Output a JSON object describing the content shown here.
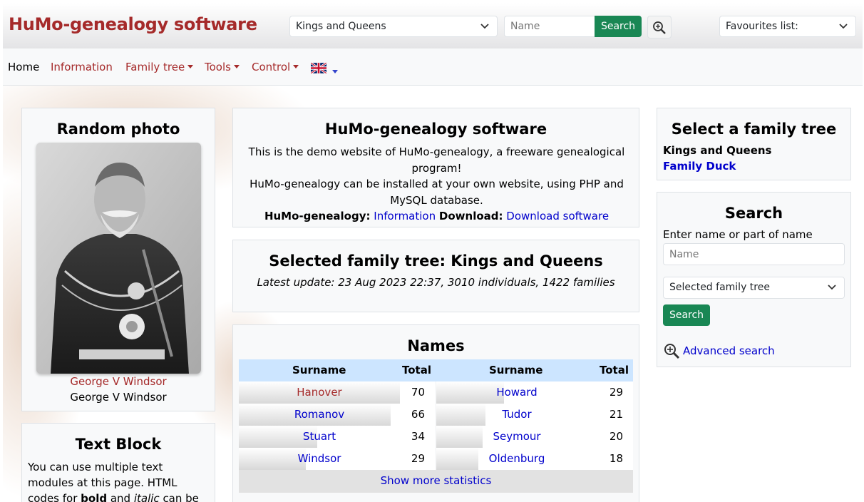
{
  "header": {
    "site_title": "HuMo-genealogy software",
    "tree_select_value": "Kings and Queens",
    "name_placeholder": "Name",
    "search_label": "Search",
    "favourites_label": "Favourites list:"
  },
  "nav": {
    "items": [
      {
        "label": "Home"
      },
      {
        "label": "Information"
      },
      {
        "label": "Family tree"
      },
      {
        "label": "Tools"
      },
      {
        "label": "Control"
      }
    ],
    "language_icon": "uk-flag-icon"
  },
  "random_photo": {
    "title": "Random photo",
    "link_text": "George V Windsor",
    "caption": "George V Windsor"
  },
  "text_block": {
    "title": "Text Block",
    "line1": "You can use multiple text modules at this page. HTML codes for ",
    "bold": "bold",
    "and": " and ",
    "italic": "italic",
    "tail": " can be"
  },
  "intro": {
    "title": "HuMo-genealogy software",
    "line1": "This is the demo website of HuMo-genealogy, a freeware genealogical program!",
    "line2": "HuMo-genealogy can be installed at your own website, using PHP and MySQL database.",
    "label_humo": "HuMo-genealogy:",
    "link_information": "Information",
    "label_download": "Download:",
    "link_download": "Download software"
  },
  "selected_tree": {
    "title": "Selected family tree: Kings and Queens",
    "update": "Latest update: 23 Aug 2023 22:37, 3010 individuals, 1422 families"
  },
  "names": {
    "title": "Names",
    "col_surname": "Surname",
    "col_total": "Total",
    "rows": [
      {
        "left_name": "Hanover",
        "left_total": "70",
        "right_name": "Howard",
        "right_total": "29"
      },
      {
        "left_name": "Romanov",
        "left_total": "66",
        "right_name": "Tudor",
        "right_total": "21"
      },
      {
        "left_name": "Stuart",
        "left_total": "34",
        "right_name": "Seymour",
        "right_total": "20"
      },
      {
        "left_name": "Windsor",
        "left_total": "29",
        "right_name": "Oldenburg",
        "right_total": "18"
      }
    ],
    "show_more": "Show more statistics"
  },
  "select_family_tree": {
    "title": "Select a family tree",
    "current": "Kings and Queens",
    "other": "Family Duck"
  },
  "side_search": {
    "title": "Search",
    "label": "Enter name or part of name",
    "name_placeholder": "Name",
    "tree_select_value": "Selected family tree",
    "button": "Search",
    "advanced": "Advanced search"
  },
  "colors": {
    "brand": "#a52a2a",
    "button_green": "#198754",
    "link_blue": "#0000cc",
    "table_header": "#cce5ff"
  }
}
